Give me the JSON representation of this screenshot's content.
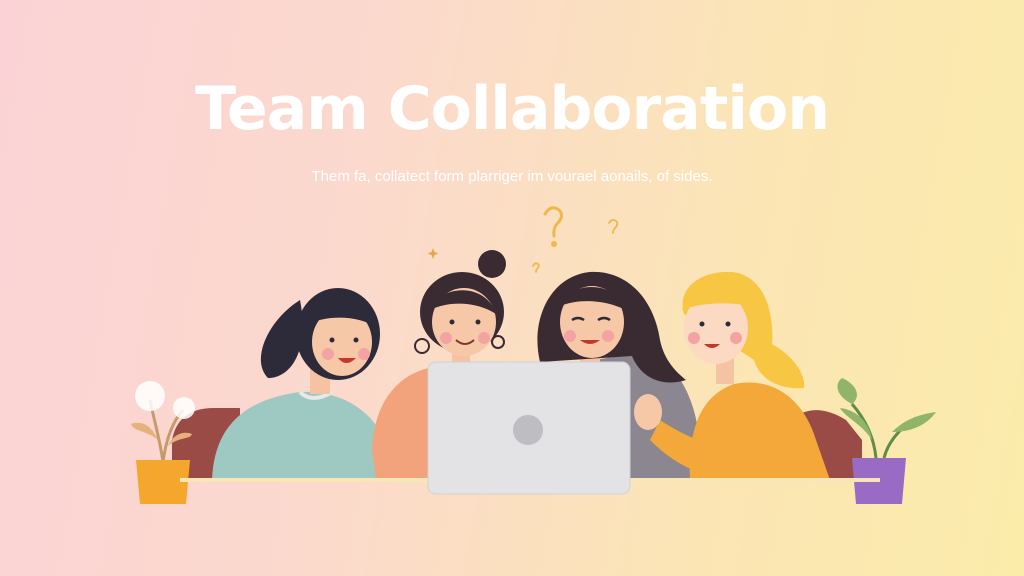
{
  "hero": {
    "title": "Team Collaboration",
    "subtitle": "Them fa, collatect form plarriger im vourael aonails, of sides."
  },
  "colors": {
    "background_left": "#fbd3d6",
    "background_right": "#fbecaa",
    "text": "#ffffff",
    "laptop": "#e2e2e4",
    "accent_question_marks": "#f0b84a"
  },
  "illustration": {
    "people": [
      {
        "name": "person-left",
        "hair": "dark",
        "top": "teal sweater"
      },
      {
        "name": "person-center-left",
        "hair": "dark bun",
        "top": "peach sweater"
      },
      {
        "name": "person-center-right",
        "hair": "dark",
        "top": "grey sweater"
      },
      {
        "name": "person-right",
        "hair": "blonde",
        "top": "orange sweater"
      }
    ],
    "props": [
      "laptop-icon",
      "yellow-plant-pot-icon",
      "purple-plant-pot-icon",
      "question-mark-icon"
    ]
  }
}
